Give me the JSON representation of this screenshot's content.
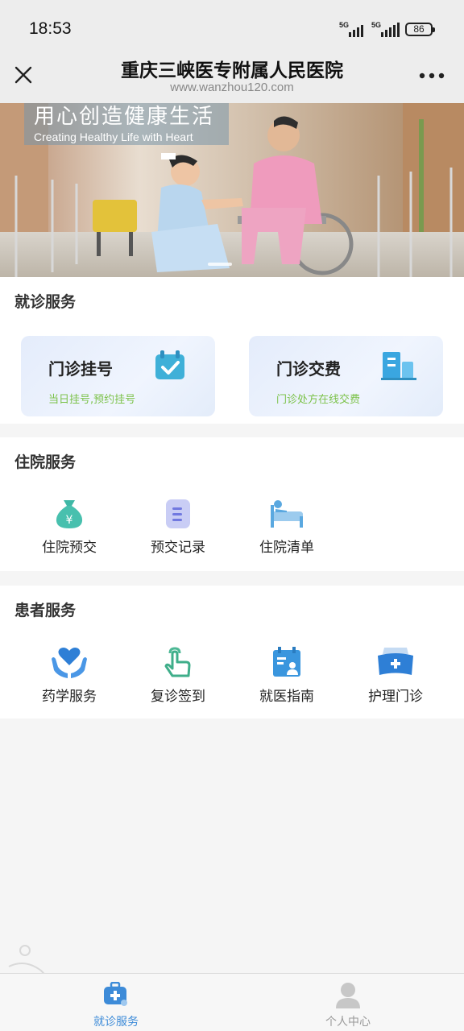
{
  "status_bar": {
    "time": "18:53",
    "sim1": "5G",
    "sim2": "5G",
    "battery": "86"
  },
  "nav": {
    "title": "重庆三峡医专附属人民医院",
    "url": "www.wanzhou120.com"
  },
  "banner": {
    "headline": "用心创造健康生活",
    "subline": "Creating Healthy Life with Heart"
  },
  "visit_services": {
    "title": "就诊服务",
    "cards": [
      {
        "title": "门诊挂号",
        "subtitle": "当日挂号,预约挂号",
        "icon": "calendar-check-icon"
      },
      {
        "title": "门诊交费",
        "subtitle": "门诊处方在线交费",
        "icon": "building-icon"
      }
    ]
  },
  "inpatient_services": {
    "title": "住院服务",
    "items": [
      {
        "label": "住院预交",
        "icon": "money-bag-icon"
      },
      {
        "label": "预交记录",
        "icon": "record-list-icon"
      },
      {
        "label": "住院清单",
        "icon": "hospital-bed-icon"
      }
    ]
  },
  "patient_services": {
    "title": "患者服务",
    "items": [
      {
        "label": "药学服务",
        "icon": "heart-hands-icon"
      },
      {
        "label": "复诊签到",
        "icon": "finger-tap-icon"
      },
      {
        "label": "就医指南",
        "icon": "guide-calendar-icon"
      },
      {
        "label": "护理门诊",
        "icon": "nurse-cap-icon"
      }
    ]
  },
  "tabbar": {
    "tabs": [
      {
        "label": "就诊服务",
        "icon": "medical-kit-icon",
        "active": true
      },
      {
        "label": "个人中心",
        "icon": "user-icon",
        "active": false
      }
    ]
  },
  "colors": {
    "accent_blue": "#3d8bd8",
    "subtitle_green": "#7cc24a",
    "teal": "#3fb8a6",
    "inactive_gray": "#999999"
  }
}
